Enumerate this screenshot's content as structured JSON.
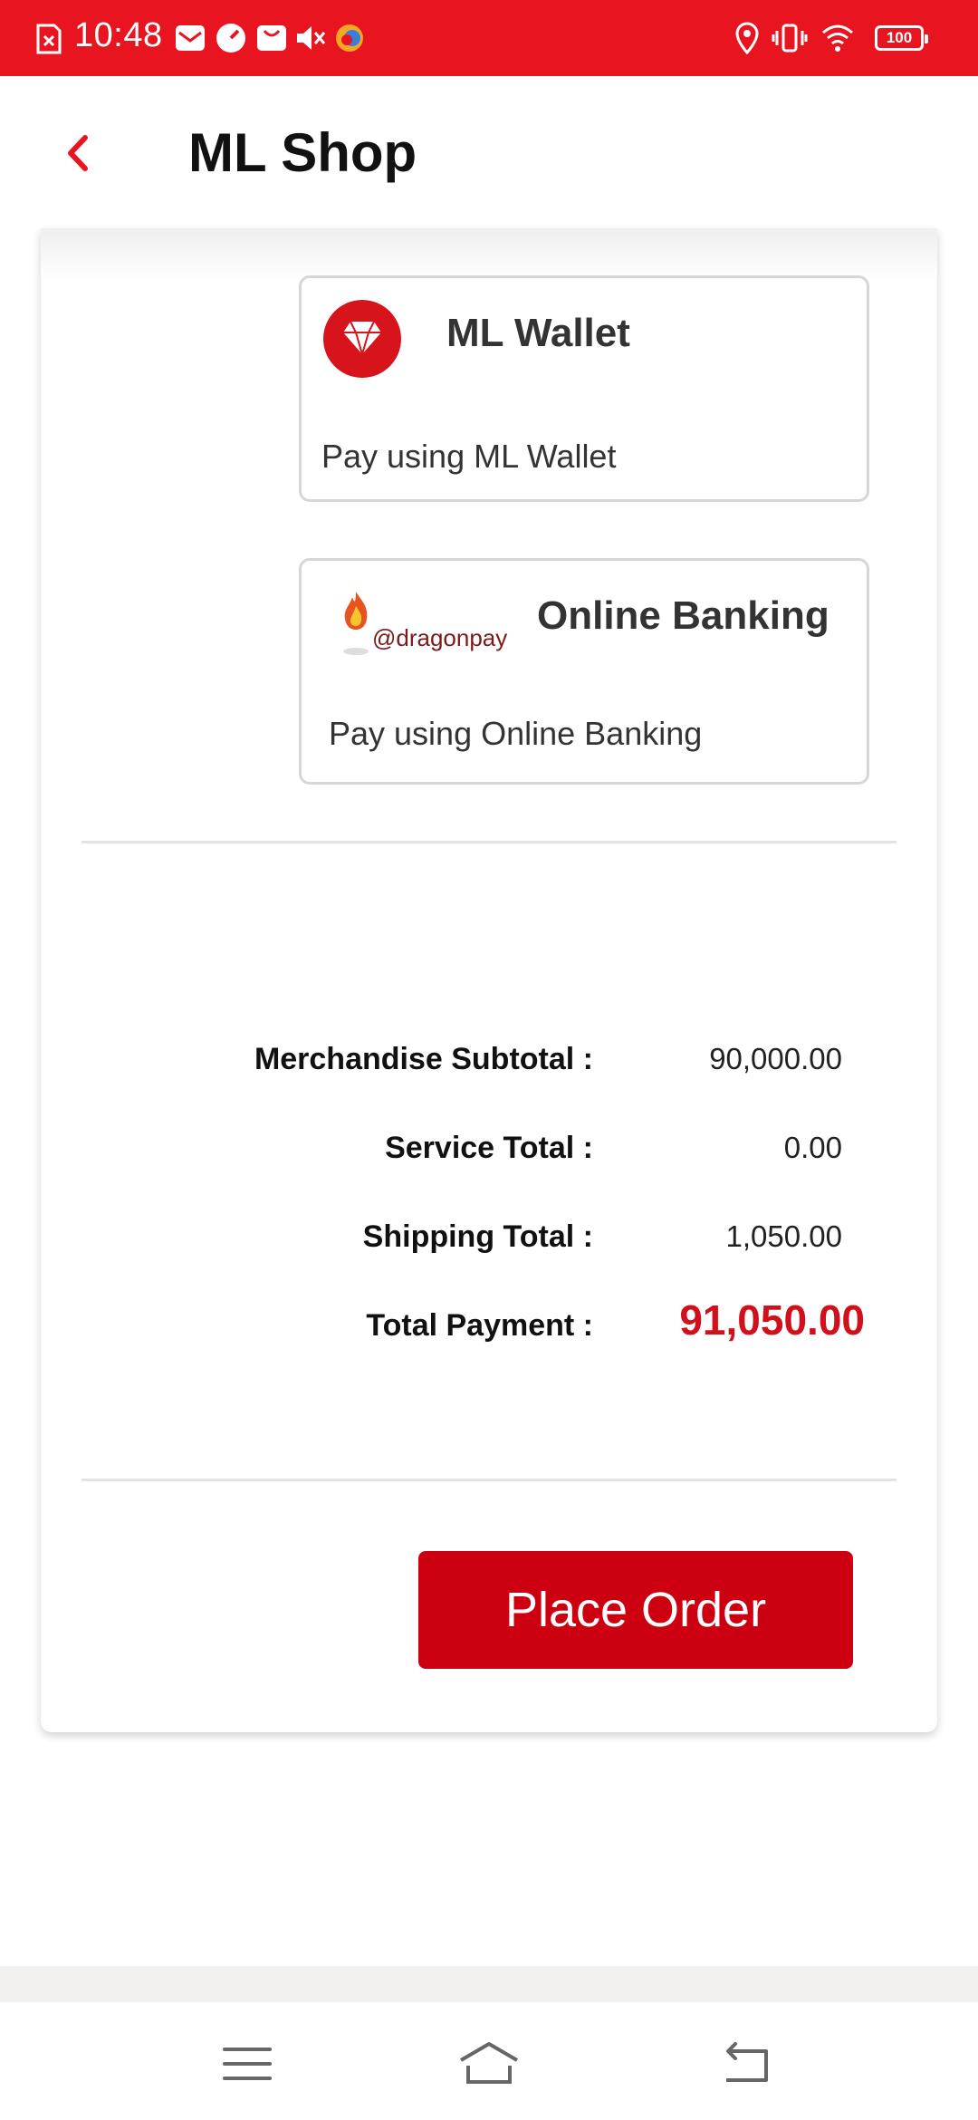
{
  "status_bar": {
    "time": "10:48",
    "battery": "100",
    "icons": [
      "sim-alert-icon",
      "mail-icon",
      "speed-icon",
      "shop-icon",
      "mute-icon",
      "app-icon",
      "location-icon",
      "vibrate-icon",
      "wifi-icon",
      "battery-icon"
    ],
    "background_color": "#e8141f"
  },
  "app_bar": {
    "title": "ML Shop",
    "back_icon": "chevron-left-icon",
    "accent_color": "#e8141f"
  },
  "payment_options": [
    {
      "title": "ML Wallet",
      "description": "Pay using ML Wallet",
      "logo": "ml-wallet-logo"
    },
    {
      "title": "Online Banking",
      "description": "Pay using Online Banking",
      "logo": "dragonpay-logo",
      "logo_text": "@dragonpay"
    }
  ],
  "summary": {
    "rows": [
      {
        "label": "Merchandise Subtotal :",
        "value": "90,000.00"
      },
      {
        "label": "Service Total :",
        "value": "0.00"
      },
      {
        "label": "Shipping Total :",
        "value": "1,050.00"
      },
      {
        "label": "Total Payment :",
        "value": "91,050.00"
      }
    ],
    "total_color": "#d0111c"
  },
  "place_order": {
    "label": "Place Order",
    "color": "#cc0010"
  },
  "nav_bar": {
    "buttons": [
      "menu-icon",
      "home-icon",
      "back-icon"
    ]
  }
}
